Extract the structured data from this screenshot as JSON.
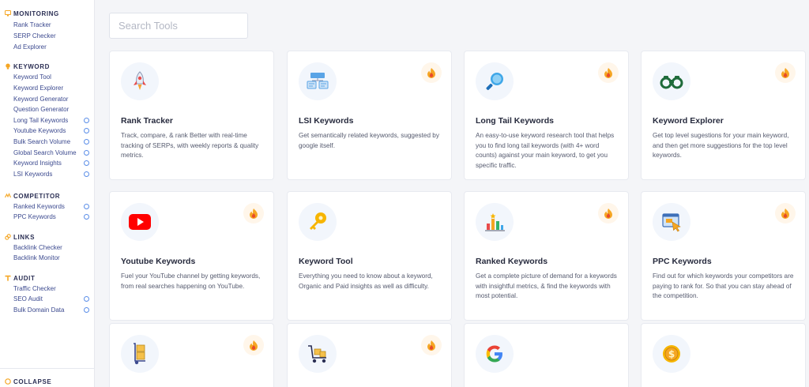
{
  "sidebar": {
    "monitoring": {
      "title": "MONITORING",
      "items": [
        "Rank Tracker",
        "SERP Checker",
        "Ad Explorer"
      ]
    },
    "keyword": {
      "title": "KEYWORD",
      "items": [
        "Keyword Tool",
        "Keyword Explorer",
        "Keyword Generator",
        "Question Generator",
        "Long Tail Keywords",
        "Youtube Keywords",
        "Bulk Search Volume",
        "Global Search Volume",
        "Keyword Insights",
        "LSI Keywords"
      ]
    },
    "competitor": {
      "title": "COMPETITOR",
      "items": [
        "Ranked Keywords",
        "PPC Keywords"
      ]
    },
    "links": {
      "title": "LINKS",
      "items": [
        "Backlink Checker",
        "Backlink Monitor"
      ]
    },
    "audit": {
      "title": "AUDIT",
      "items": [
        "Traffic Checker",
        "SEO Audit",
        "Bulk Domain Data"
      ]
    },
    "collapse_label": "COLLAPSE"
  },
  "search": {
    "placeholder": "Search Tools",
    "value": ""
  },
  "tools": [
    {
      "title": "Rank Tracker",
      "desc": "Track, compare, & rank Better with real-time tracking of SERPs, with weekly reports & quality metrics.",
      "icon": "rocket-icon",
      "hot": false
    },
    {
      "title": "LSI Keywords",
      "desc": "Get semantically related keywords, suggested by google itself.",
      "icon": "sitemap-icon",
      "hot": true
    },
    {
      "title": "Long Tail Keywords",
      "desc": "An easy-to-use keyword research tool that helps you to find long tail keywords (with 4+ word counts) against your main keyword, to get you specific traffic.",
      "icon": "magnifier-icon",
      "hot": true
    },
    {
      "title": "Keyword Explorer",
      "desc": "Get top level sugestions for your main keyword, and then get more suggestions for the top level keywords.",
      "icon": "binoculars-icon",
      "hot": true
    },
    {
      "title": "Youtube Keywords",
      "desc": "Fuel your YouTube channel by getting keywords, from real searches happening on YouTube.",
      "icon": "youtube-icon",
      "hot": true
    },
    {
      "title": "Keyword Tool",
      "desc": "Everything you need to know about a keyword, Organic and Paid insights as well as difficulty.",
      "icon": "key-icon",
      "hot": false
    },
    {
      "title": "Ranked Keywords",
      "desc": "Get a complete picture of demand for a keywords with insightful metrics, & find the keywords with most potential.",
      "icon": "bar-chart-icon",
      "hot": true
    },
    {
      "title": "PPC Keywords",
      "desc": "Find out for which keywords your competitors are paying to rank for. So that you can stay ahead of the competition.",
      "icon": "ad-click-icon",
      "hot": true
    },
    {
      "title": "",
      "desc": "",
      "icon": "hand-truck-icon",
      "hot": true
    },
    {
      "title": "",
      "desc": "",
      "icon": "cart-icon",
      "hot": true
    },
    {
      "title": "",
      "desc": "",
      "icon": "google-icon",
      "hot": false
    },
    {
      "title": "",
      "desc": "",
      "icon": "dollar-coin-icon",
      "hot": false
    }
  ],
  "colors": {
    "accent": "#f5a623",
    "new_dot": "#5b8ee8",
    "nav_text": "#3c4a8f",
    "youtube_red": "#ff0000"
  }
}
